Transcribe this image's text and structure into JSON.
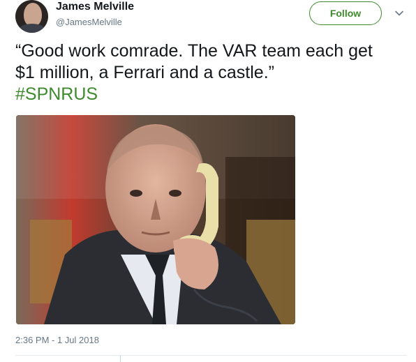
{
  "author": {
    "name": "James Melville",
    "handle": "@JamesMelville",
    "avatar_icon": "profile-photo"
  },
  "actions": {
    "follow_label": "Follow",
    "menu_icon": "chevron-down-icon"
  },
  "tweet": {
    "line1": "“Good work comrade. The VAR team each get",
    "line2": "$1 million, a Ferrari and a castle.”",
    "hashtag": "#SPNRUS",
    "timestamp": "2:36 PM - 1 Jul 2018"
  },
  "colors": {
    "accent": "#3d8b2c",
    "text": "#14171a",
    "muted": "#657786",
    "border": "#e6ecf0"
  }
}
